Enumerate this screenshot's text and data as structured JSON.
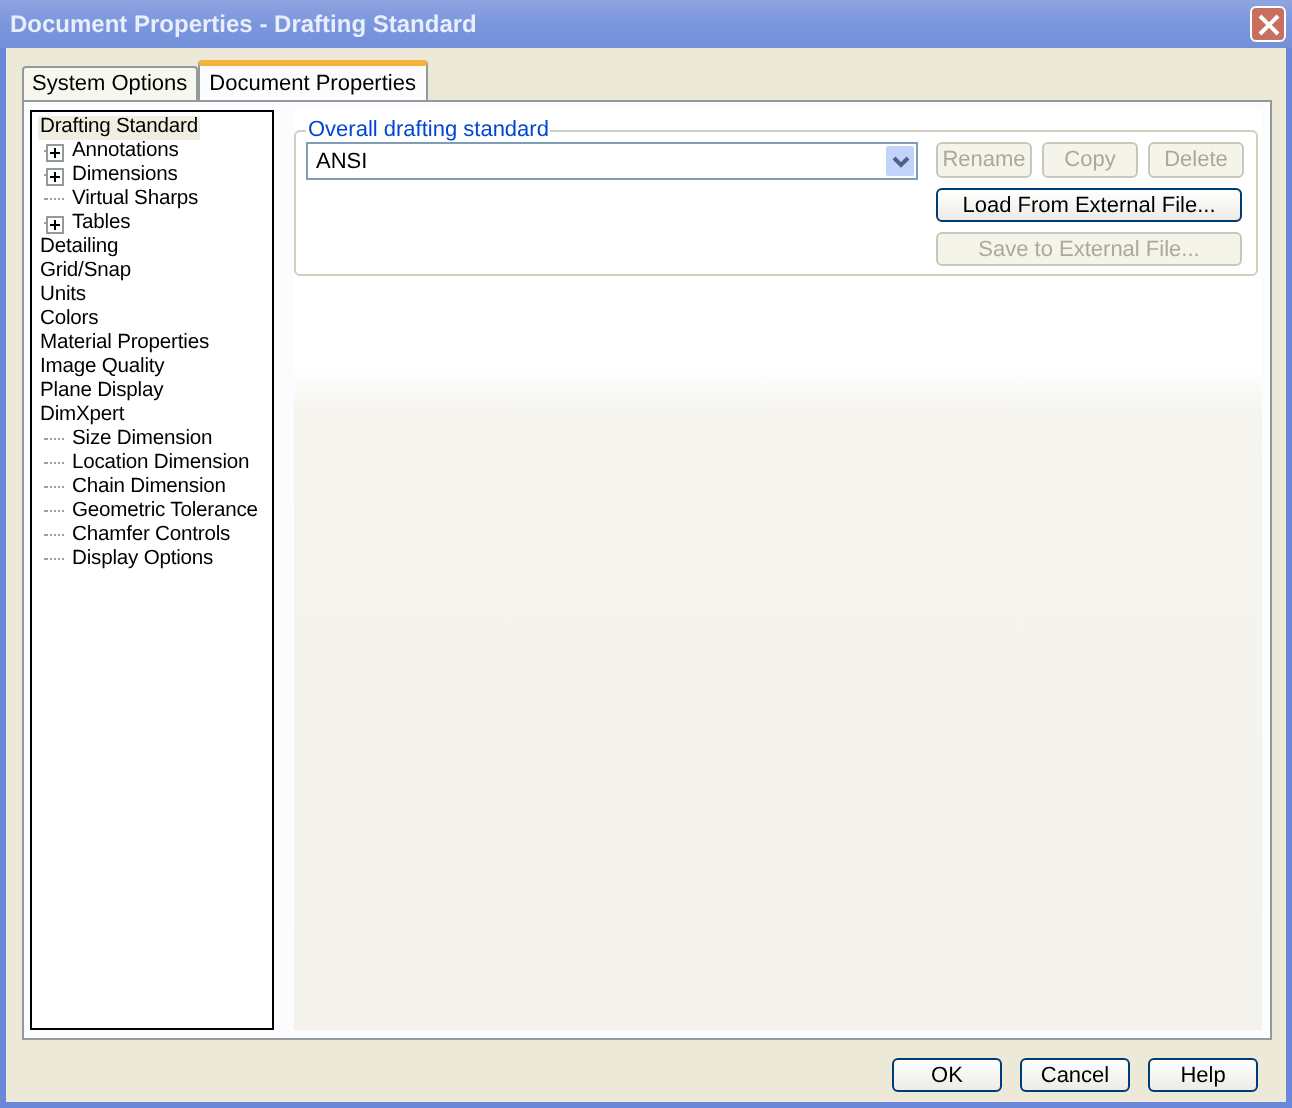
{
  "window": {
    "title": "Document Properties - Drafting Standard"
  },
  "tabs": [
    {
      "label": "System Options",
      "selected": false
    },
    {
      "label": "Document Properties",
      "selected": true
    }
  ],
  "tree": [
    {
      "label": "Drafting Standard",
      "selected": true,
      "children": [
        {
          "label": "Annotations",
          "selected": false,
          "expanded": false
        },
        {
          "label": "Dimensions",
          "selected": false,
          "expanded": false
        },
        {
          "label": "Virtual Sharps",
          "selected": false
        },
        {
          "label": "Tables",
          "selected": false,
          "expanded": false
        }
      ]
    },
    {
      "label": "Detailing",
      "selected": false
    },
    {
      "label": "Grid/Snap",
      "selected": false
    },
    {
      "label": "Units",
      "selected": false
    },
    {
      "label": "Colors",
      "selected": false
    },
    {
      "label": "Material Properties",
      "selected": false
    },
    {
      "label": "Image Quality",
      "selected": false
    },
    {
      "label": "Plane Display",
      "selected": false
    },
    {
      "label": "DimXpert",
      "selected": false,
      "children": [
        {
          "label": "Size Dimension",
          "selected": false
        },
        {
          "label": "Location Dimension",
          "selected": false
        },
        {
          "label": "Chain Dimension",
          "selected": false
        },
        {
          "label": "Geometric Tolerance",
          "selected": false
        },
        {
          "label": "Chamfer Controls",
          "selected": false
        },
        {
          "label": "Display Options",
          "selected": false
        }
      ]
    }
  ],
  "standard_group": {
    "legend": "Overall drafting standard",
    "dropdown_value": "ANSI",
    "side_buttons": [
      {
        "label": "Rename",
        "disabled": true
      },
      {
        "label": "Copy",
        "disabled": true
      },
      {
        "label": "Delete",
        "disabled": true
      }
    ],
    "file_buttons": [
      {
        "label": "Load From External File...",
        "disabled": false
      },
      {
        "label": "Save to External File...",
        "disabled": true
      }
    ]
  },
  "buttons": [
    "OK",
    "Cancel",
    "Help"
  ]
}
